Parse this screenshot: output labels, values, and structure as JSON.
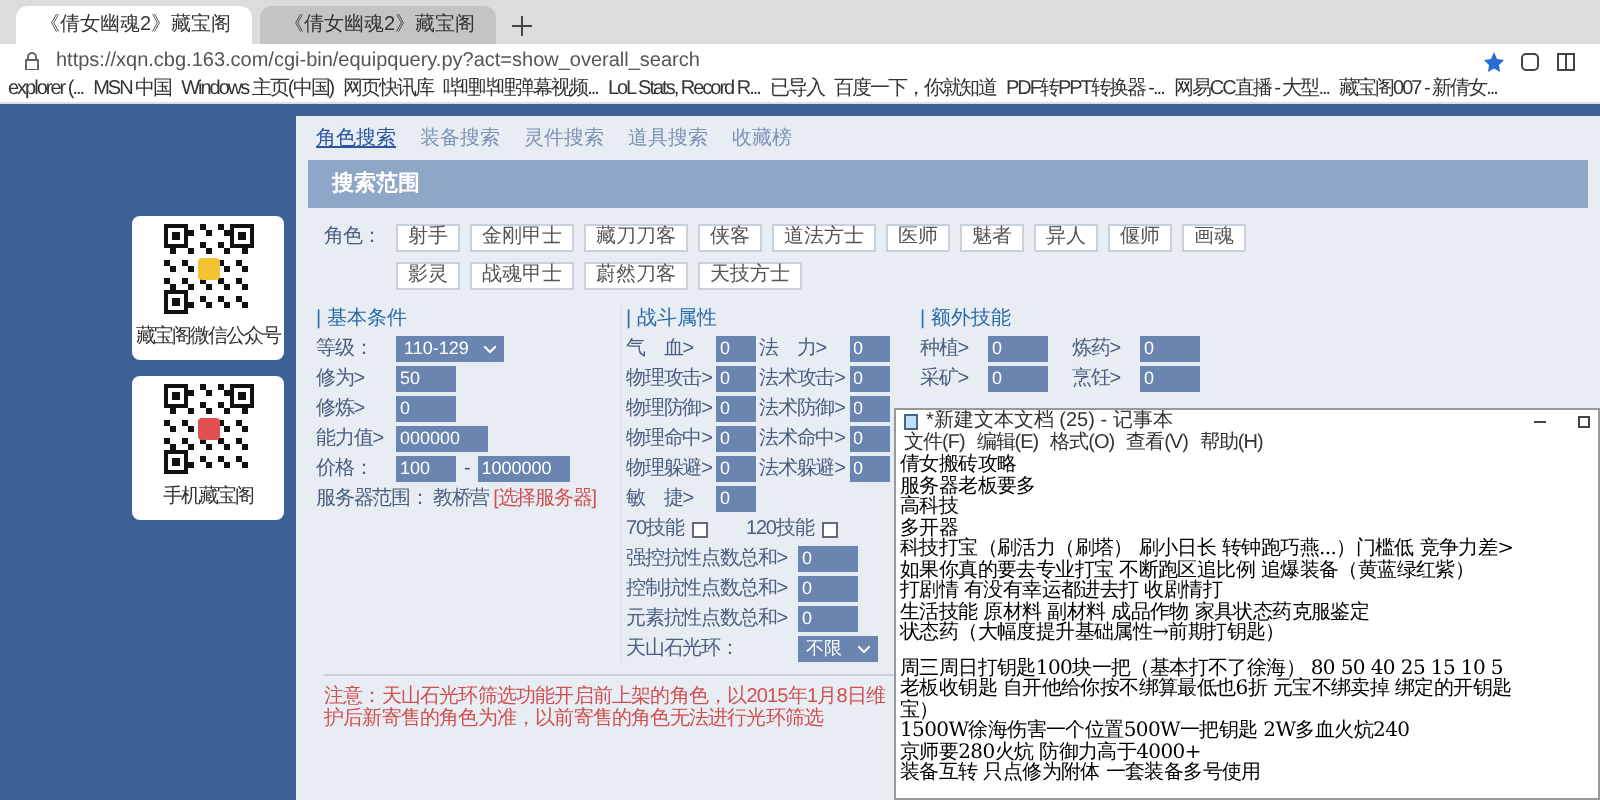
{
  "browser": {
    "tabs": [
      {
        "title": "《倩女幽魂2》藏宝阁",
        "selected": true
      },
      {
        "title": "《倩女幽魂2》藏宝阁",
        "selected": false
      }
    ],
    "url": "https://xqn.cbg.163.com/cgi-bin/equipquery.py?act=show_overall_search",
    "bookmarks": [
      "explorer (...",
      "MSN 中国",
      "Windows 主页(中国)",
      "网页快讯库",
      "哔哩哔哩弹幕视频...",
      "LoL Stats, Record R...",
      "已导入",
      "百度一下，你就知道",
      "PDF转PPT转换器 -...",
      "网易CC直播 - 大型...",
      "藏宝阁007 - 新倩女..."
    ]
  },
  "qr_cards": [
    {
      "caption": "藏宝阁微信公众号"
    },
    {
      "caption": "手机藏宝阁"
    }
  ],
  "nav_tabs": [
    {
      "label": "角色搜索",
      "selected": true
    },
    {
      "label": "装备搜索",
      "selected": false
    },
    {
      "label": "灵件搜索",
      "selected": false
    },
    {
      "label": "道具搜索",
      "selected": false
    },
    {
      "label": "收藏榜",
      "selected": false
    }
  ],
  "section_title": "搜索范围",
  "roles": {
    "label": "角色：",
    "buttons": [
      "射手",
      "金刚甲士",
      "藏刀刀客",
      "侠客",
      "道法方士",
      "医师",
      "魅者",
      "异人",
      "偃师",
      "画魂",
      "影灵",
      "战魂甲士",
      "蔚然刀客",
      "天技方士"
    ]
  },
  "basic": {
    "title": "| 基本条件",
    "rows": [
      {
        "kind": "select",
        "label": "等级：",
        "value": "110-129"
      },
      {
        "kind": "input",
        "label": "修为>",
        "value": "50"
      },
      {
        "kind": "input",
        "label": "修炼>",
        "value": "0"
      },
      {
        "kind": "input",
        "label": "能力值>",
        "value": "000000"
      },
      {
        "kind": "range",
        "label": "价格：",
        "value": "100",
        "sep": "-",
        "value2": "1000000"
      },
      {
        "kind": "server",
        "label": "服务器范围：",
        "value": "教桥营",
        "link": "[选择服务器]"
      }
    ]
  },
  "combat": {
    "title": "| 战斗属性",
    "rows": [
      {
        "kind": "pair",
        "fields": [
          {
            "label": "气　血>",
            "value": "0"
          },
          {
            "label": "法　力>",
            "value": "0"
          }
        ]
      },
      {
        "kind": "pair",
        "fields": [
          {
            "label": "物理攻击>",
            "value": "0"
          },
          {
            "label": "法术攻击>",
            "value": "0"
          }
        ]
      },
      {
        "kind": "pair",
        "fields": [
          {
            "label": "物理防御>",
            "value": "0"
          },
          {
            "label": "法术防御>",
            "value": "0"
          }
        ]
      },
      {
        "kind": "pair",
        "fields": [
          {
            "label": "物理命中>",
            "value": "0"
          },
          {
            "label": "法术命中>",
            "value": "0"
          }
        ]
      },
      {
        "kind": "pair",
        "fields": [
          {
            "label": "物理躲避>",
            "value": "0"
          },
          {
            "label": "法术躲避>",
            "value": "0"
          }
        ]
      },
      {
        "kind": "pair",
        "fields": [
          {
            "label": "敏　捷>",
            "value": "0"
          }
        ]
      },
      {
        "kind": "checks",
        "items": [
          {
            "label": "70技能",
            "checked": false
          },
          {
            "label": "120技能",
            "checked": false
          }
        ]
      },
      {
        "kind": "wide",
        "label": "强控抗性点数总和>",
        "value": "0"
      },
      {
        "kind": "wide",
        "label": "控制抗性点数总和>",
        "value": "0"
      },
      {
        "kind": "wide",
        "label": "元素抗性点数总和>",
        "value": "0"
      },
      {
        "kind": "select",
        "label": "天山石光环：",
        "value": "不限"
      }
    ]
  },
  "extra": {
    "title": "| 额外技能",
    "rows": [
      {
        "fields": [
          {
            "label": "种植>",
            "value": "0"
          },
          {
            "label": "炼药>",
            "value": "0"
          }
        ]
      },
      {
        "fields": [
          {
            "label": "采矿>",
            "value": "0"
          },
          {
            "label": "烹饪>",
            "value": "0"
          }
        ]
      }
    ]
  },
  "note": "注意：天山石光环筛选功能开启前上架的角色，以2015年1月8日维护后新寄售的角色为准，以前寄售的角色无法进行光环筛选",
  "notepad": {
    "title": "*新建文本文档 (25) - 记事本",
    "menu": [
      "文件(F)",
      "编辑(E)",
      "格式(O)",
      "查看(V)",
      "帮助(H)"
    ],
    "paragraphs": [
      [
        "倩女搬砖攻略",
        "服务器老板要多",
        "高科技",
        "多开器",
        "科技打宝（刷活力（刷塔） 刷小日长 转钟跑巧燕...）门槛低 竞争力差>",
        "如果你真的要去专业打宝 不断跑区追比例 追爆装备（黄蓝绿红紫）",
        "打剧情 有没有幸运都进去打 收剧情打",
        "生活技能 原材料 副材料 成品作物 家具状态药克服鉴定",
        "状态药（大幅度提升基础属性→前期打钥匙）"
      ],
      [
        "周三周日打钥匙100块一把（基本打不了徐海） 80 50 40 25 15 10 5",
        "老板收钥匙 自开他给你按不绑算最低也6折 元宝不绑卖掉 绑定的开钥匙",
        "宝）",
        "1500W徐海伤害一个位置500W一把钥匙 2W多血火炕240",
        "京师要280火炕 防御力高于4000+",
        "装备互转 只点修为附体 一套装备多号使用"
      ]
    ]
  }
}
